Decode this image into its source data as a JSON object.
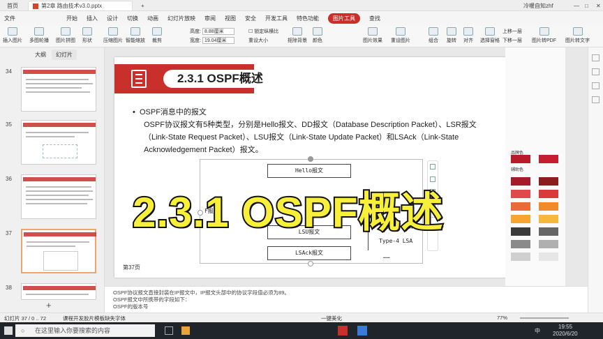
{
  "window": {
    "home_tab": "首页",
    "doc_tab": "第2章 路由技术v3.0.pptx",
    "user": "冷暖自知zhf"
  },
  "menu": [
    "文件",
    "开始",
    "插入",
    "设计",
    "切换",
    "动画",
    "幻灯片放映",
    "审阅",
    "视图",
    "安全",
    "开发工具",
    "特色功能",
    "图片工具",
    "查找"
  ],
  "ribbon": {
    "buttons": [
      "插入图片",
      "多图轮播",
      "图片拼图",
      "形状",
      "压缩图片",
      "智能缩放",
      "裁剪",
      "图片",
      "抠除背景",
      "颜色",
      "图片效果",
      "重设图片",
      "组合",
      "旋转",
      "对齐",
      "选择窗格",
      "上移一层",
      "下移一层",
      "图片转PDF",
      "图片转文字"
    ],
    "height_label": "高度:",
    "height_value": "8.88厘米",
    "width_label": "宽度:",
    "width_value": "19.04厘米",
    "lock": "锁定纵横比",
    "reset": "重设大小"
  },
  "sidebar": {
    "tab_outline": "大纲",
    "tab_slides": "幻灯片",
    "slides": [
      {
        "num": "34",
        "title": "2.3.1 OSPF概述"
      },
      {
        "num": "35",
        "title": "2.3.1 OSPF概述"
      },
      {
        "num": "36",
        "title": "2.3.1 OSPF概述"
      },
      {
        "num": "37",
        "title": "2.3.1 OSPF概述"
      },
      {
        "num": "38",
        "title": "2.3.1 OSPF概述"
      }
    ]
  },
  "slide": {
    "title": "2.3.1 OSPF概述",
    "bullet": "OSPF消息中的报文",
    "body": "OSPF协议报文有5种类型，分别是Hello报文、DD报文（Database Description Packet）、LSR报文（Link-State Request Packet）、LSU报文（Link-State Update Packet）和LSAck（Link-State Acknowledgement Packet）报文。",
    "packets": {
      "hello": "Hello报文",
      "lsu": "LSU报文",
      "lsack": "LSAck报文",
      "left": "F报文"
    },
    "lsa": [
      "Type-3 LSA",
      "Type-4 LSA",
      "……"
    ],
    "page": "第37页"
  },
  "overlay_caption": "2.3.1 OSPF概述",
  "right_panel": {
    "brand_label": "品牌色",
    "assist_label": "辅助色"
  },
  "notes": [
    "OSPF协议报文直接封装在IP报文中，IP报文头部中的协议字段值必须为89。",
    "OSPF报文中所携带的字段如下：",
    "OSPF的版本号"
  ],
  "status": {
    "slide_info": "幻灯片 37 / 0 .. 72",
    "template": "课程开发胶片模板",
    "font": "缺失字体",
    "beautify": "一键美化",
    "zoom": "77%"
  },
  "taskbar": {
    "search_placeholder": "在这里输入你要搜索的内容",
    "ime": "中",
    "time": "19:55",
    "date": "2020/6/20"
  }
}
